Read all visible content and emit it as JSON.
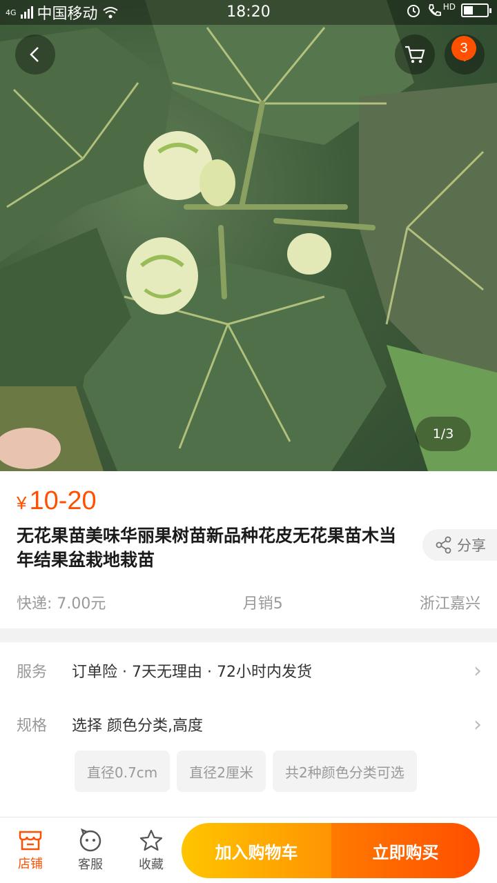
{
  "status_bar": {
    "network": "4G",
    "carrier": "中国移动",
    "time": "18:20",
    "hd_label": "HD",
    "battery_level": 0.4
  },
  "top_nav": {
    "back_icon": "chevron-left-icon",
    "cart_icon": "cart-icon",
    "more_icon": "more-dots-icon",
    "cart_badge": "3"
  },
  "gallery": {
    "pager": "1/3"
  },
  "product": {
    "currency": "¥",
    "price": "10-20",
    "title": "无花果苗美味华丽果树苗新品种花皮无花果苗木当年结果盆栽地栽苗",
    "share_label": "分享",
    "shipping": "快递: 7.00元",
    "monthly_sales": "月销5",
    "location": "浙江嘉兴"
  },
  "service": {
    "label": "服务",
    "text": "订单险 · 7天无理由 · 72小时内发货"
  },
  "spec": {
    "label": "规格",
    "text": "选择 颜色分类,高度",
    "chips": [
      "直径0.7cm",
      "直径2厘米",
      "共2种颜色分类可选"
    ]
  },
  "bottom_bar": {
    "store_label": "店铺",
    "service_label": "客服",
    "favorite_label": "收藏",
    "add_to_cart_label": "加入购物车",
    "buy_now_label": "立即购买"
  },
  "colors": {
    "accent": "#ff5000",
    "cart_gradient_start": "#ffc500",
    "cart_gradient_end": "#ff9402",
    "buy_gradient_start": "#ff7a00",
    "buy_gradient_end": "#ff4e00"
  }
}
